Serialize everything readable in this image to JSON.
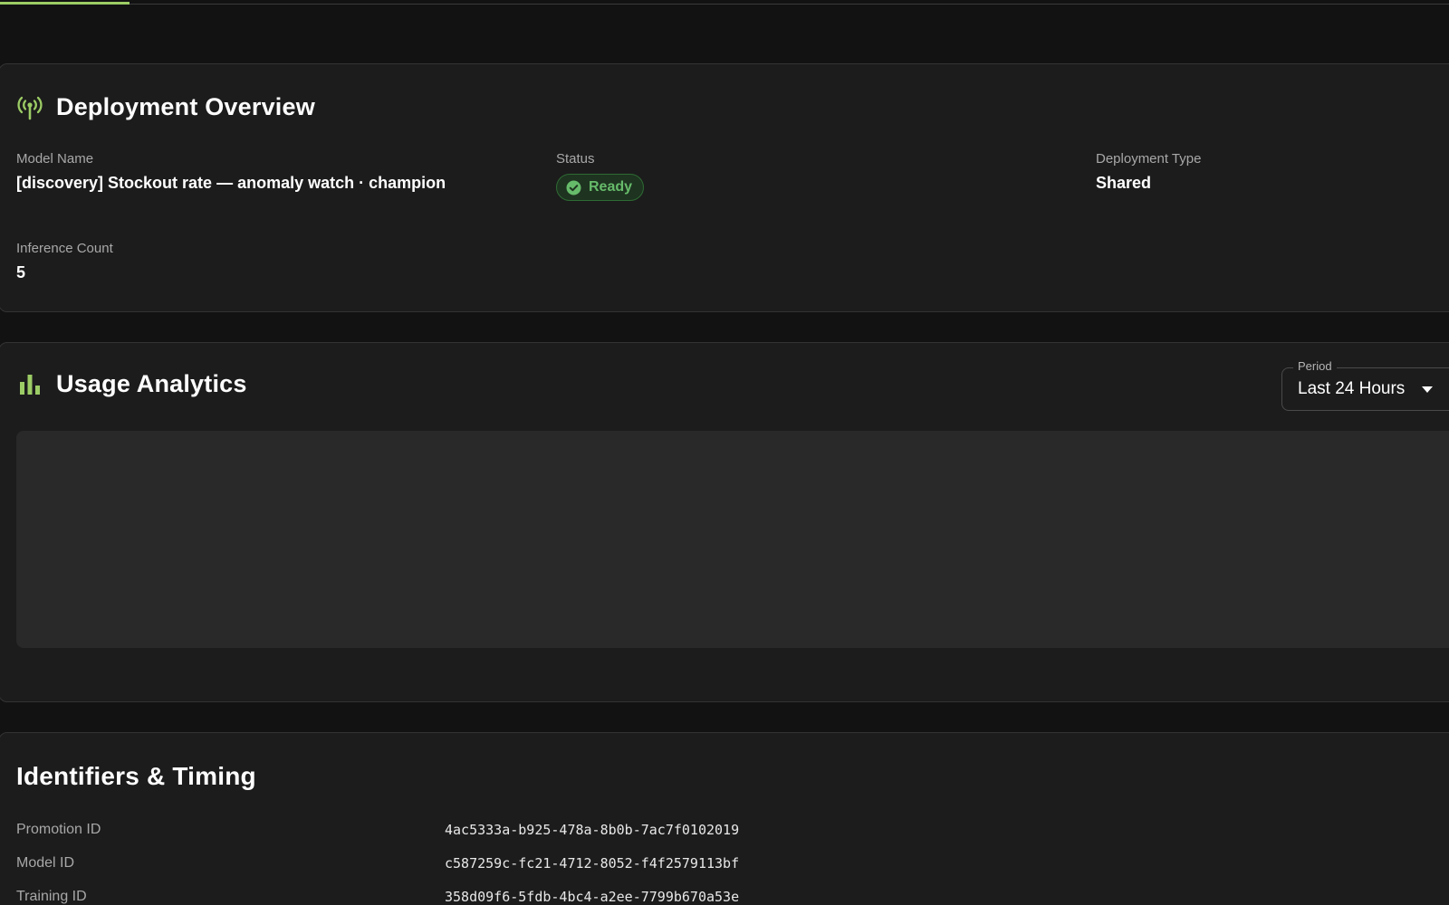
{
  "progress": {
    "value_fraction": 0.09,
    "accent_color": "#9ccc65"
  },
  "overview": {
    "title": "Deployment Overview",
    "icon": "broadcast-antenna-icon",
    "model_name_label": "Model Name",
    "model_name": "[discovery] Stockout rate — anomaly watch · champion",
    "status_label": "Status",
    "status": "Ready",
    "deployment_type_label": "Deployment Type",
    "deployment_type": "Shared",
    "inference_count_label": "Inference Count",
    "inference_count": "5"
  },
  "usage": {
    "title": "Usage Analytics",
    "icon": "bar-chart-icon",
    "period_label": "Period",
    "period_value": "Last 24 Hours"
  },
  "identifiers": {
    "title": "Identifiers & Timing",
    "rows": [
      {
        "label": "Promotion ID",
        "value": "4ac5333a-b925-478a-8b0b-7ac7f0102019"
      },
      {
        "label": "Model ID",
        "value": "c587259c-fc21-4712-8052-f4f2579113bf"
      },
      {
        "label": "Training ID",
        "value": "358d09f6-5fdb-4bc4-a2ee-7799b670a53e"
      }
    ]
  },
  "colors": {
    "accent": "#9ccc65",
    "status_green": "#66bb6a",
    "background": "#121212",
    "card": "#1c1c1c"
  }
}
